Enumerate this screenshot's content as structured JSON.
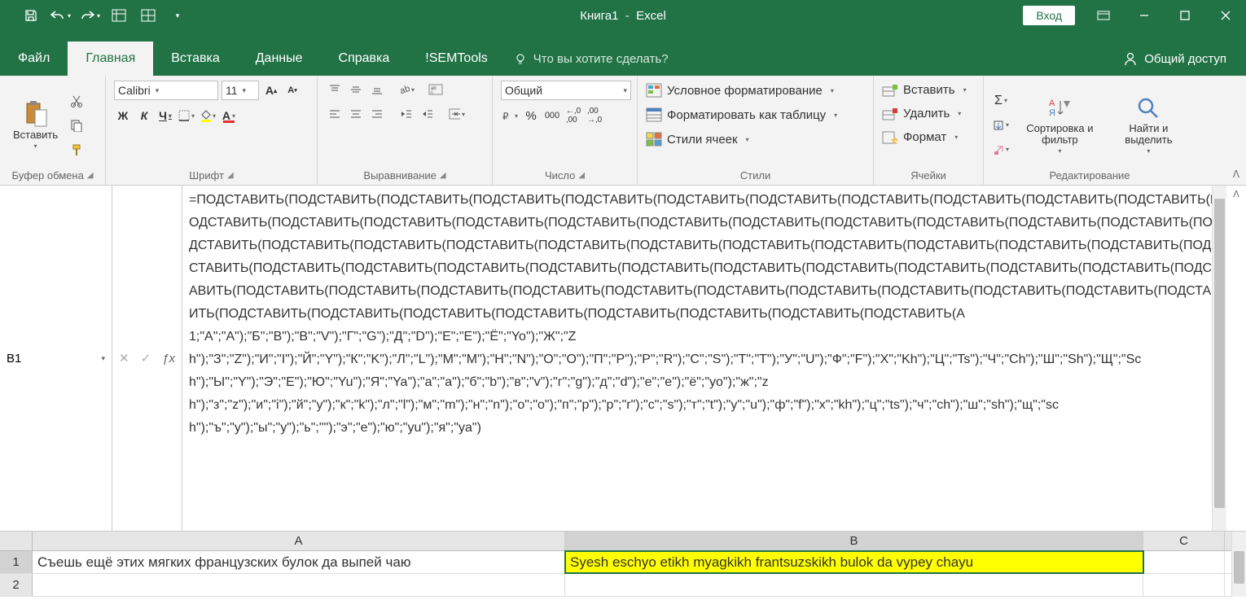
{
  "title": {
    "doc": "Книга1",
    "app": "Excel"
  },
  "login": "Вход",
  "tabs": {
    "file": "Файл",
    "home": "Главная",
    "insert": "Вставка",
    "data": "Данные",
    "help": "Справка",
    "semtools": "!SEMTools"
  },
  "tellme": "Что вы хотите сделать?",
  "share": "Общий доступ",
  "ribbon": {
    "clipboard": {
      "paste": "Вставить",
      "label": "Буфер обмена"
    },
    "font": {
      "name": "Calibri",
      "size": "11",
      "bold": "Ж",
      "italic": "К",
      "underline": "Ч",
      "label": "Шрифт"
    },
    "align": {
      "label": "Выравнивание"
    },
    "number": {
      "format": "Общий",
      "label": "Число"
    },
    "styles": {
      "cond": "Условное форматирование",
      "table": "Форматировать как таблицу",
      "cell": "Стили ячеек",
      "label": "Стили"
    },
    "cells": {
      "insert": "Вставить",
      "delete": "Удалить",
      "format": "Формат",
      "label": "Ячейки"
    },
    "editing": {
      "sort": "Сортировка и фильтр",
      "find": "Найти и выделить",
      "label": "Редактирование"
    }
  },
  "namebox": "B1",
  "formula": "=ПОДСТАВИТЬ(ПОДСТАВИТЬ(ПОДСТАВИТЬ(ПОДСТАВИТЬ(ПОДСТАВИТЬ(ПОДСТАВИТЬ(ПОДСТАВИТЬ(ПОДСТАВИТЬ(ПОДСТАВИТЬ(ПОДСТАВИТЬ(ПОДСТАВИТЬ(ПОДСТАВИТЬ(ПОДСТАВИТЬ(ПОДСТАВИТЬ(ПОДСТАВИТЬ(ПОДСТАВИТЬ(ПОДСТАВИТЬ(ПОДСТАВИТЬ(ПОДСТАВИТЬ(ПОДСТАВИТЬ(ПОДСТАВИТЬ(ПОДСТАВИТЬ(ПОДСТАВИТЬ(ПОДСТАВИТЬ(ПОДСТАВИТЬ(ПОДСТАВИТЬ(ПОДСТАВИТЬ(ПОДСТАВИТЬ(ПОДСТАВИТЬ(ПОДСТАВИТЬ(ПОДСТАВИТЬ(ПОДСТАВИТЬ(ПОДСТАВИТЬ(ПОДСТАВИТЬ(ПОДСТАВИТЬ(ПОДСТАВИТЬ(ПОДСТАВИТЬ(ПОДСТАВИТЬ(ПОДСТАВИТЬ(ПОДСТАВИТЬ(ПОДСТАВИТЬ(ПОДСТАВИТЬ(ПОДСТАВИТЬ(ПОДСТАВИТЬ(ПОДСТАВИТЬ(ПОДСТАВИТЬ(ПОДСТАВИТЬ(ПОДСТАВИТЬ(ПОДСТАВИТЬ(ПОДСТАВИТЬ(ПОДСТАВИТЬ(ПОДСТАВИТЬ(ПОДСТАВИТЬ(ПОДСТАВИТЬ(ПОДСТАВИТЬ(ПОДСТАВИТЬ(ПОДСТАВИТЬ(ПОДСТАВИТЬ(ПОДСТАВИТЬ(ПОДСТАВИТЬ(ПОДСТАВИТЬ(ПОДСТАВИТЬ(ПОДСТАВИТЬ(ПОДСТАВИТЬ(A1;\"А\";\"A\");\"Б\";\"B\");\"В\";\"V\");\"Г\";\"G\");\"Д\";\"D\");\"Е\";\"E\");\"Ё\";\"Yo\");\"Ж\";\"Zh\");\"З\";\"Z\");\"И\";\"I\");\"Й\";\"Y\");\"К\";\"K\");\"Л\";\"L\");\"М\";\"M\");\"Н\";\"N\");\"О\";\"O\");\"П\";\"P\");\"Р\";\"R\");\"С\";\"S\");\"Т\";\"T\");\"У\";\"U\");\"Ф\";\"F\");\"Х\";\"Kh\");\"Ц\";\"Ts\");\"Ч\";\"Ch\");\"Ш\";\"Sh\");\"Щ\";\"Sch\");\"Ы\";\"Y\");\"Э\";\"E\");\"Ю\";\"Yu\");\"Я\";\"Ya\");\"а\";\"a\");\"б\";\"b\");\"в\";\"v\");\"г\";\"g\");\"д\";\"d\");\"е\";\"e\");\"ё\";\"yo\");\"ж\";\"zh\");\"з\";\"z\");\"и\";\"i\");\"й\";\"y\");\"к\";\"k\");\"л\";\"l\");\"м\";\"m\");\"н\";\"n\");\"о\";\"o\");\"п\";\"p\");\"р\";\"r\");\"с\";\"s\");\"т\";\"t\");\"у\";\"u\");\"ф\";\"f\");\"х\";\"kh\");\"ц\";\"ts\");\"ч\";\"ch\");\"ш\";\"sh\");\"щ\";\"sch\");\"ъ\";\"y\");\"ы\";\"y\");\"ь\";\"\");\"э\";\"e\");\"ю\";\"yu\");\"я\";\"ya\")",
  "cells": {
    "A1": "Съешь ещё этих мягких французских булок да выпей чаю",
    "B1": "Syesh eschyo etikh myagkikh frantsuzskikh bulok da vypey chayu"
  },
  "cols": [
    "A",
    "B",
    "C"
  ],
  "rows": [
    "1",
    "2"
  ]
}
